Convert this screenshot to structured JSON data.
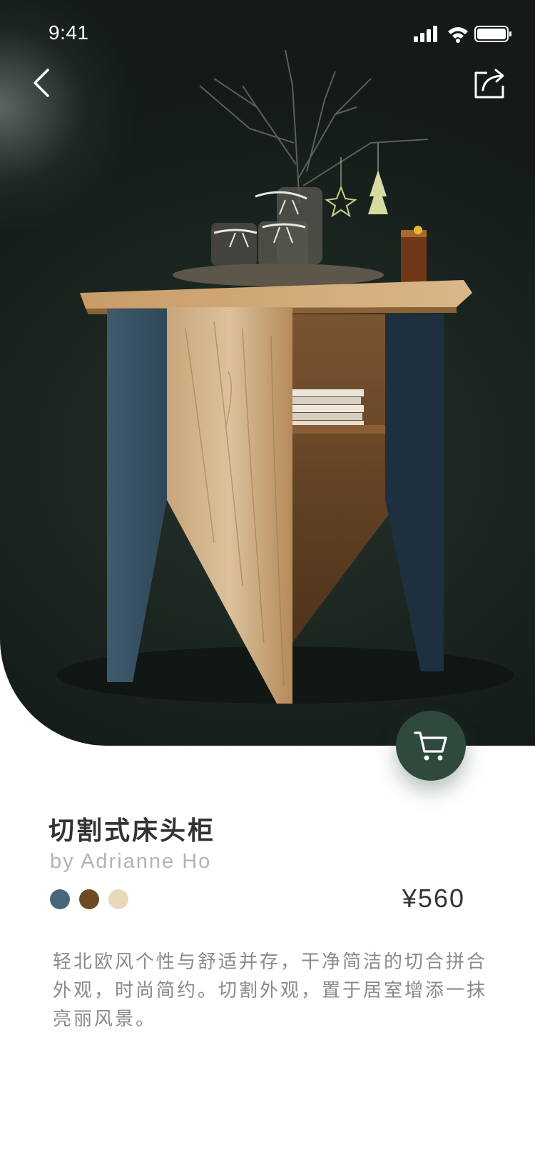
{
  "status_bar": {
    "time": "9:41",
    "icons": [
      "signal-icon",
      "wifi-icon",
      "battery-icon"
    ]
  },
  "nav": {
    "back_icon": "chevron-left-icon",
    "share_icon": "share-icon"
  },
  "hero_image": {
    "subject": "cut-style wooden bedside table with blue legs, jars and branches on top",
    "cart_button_icon": "cart-icon"
  },
  "product": {
    "title": "切割式床头柜",
    "designer": "by Adrianne Ho",
    "price": "¥560",
    "colors": [
      "#48667a",
      "#6e4a24",
      "#e8d9b9"
    ],
    "description": "轻北欧风个性与舒适并存，干净简洁的切合拼合外观，时尚简约。切割外观，置于居室增添一抹亮丽风景。"
  },
  "theme": {
    "accent": "#2f4a3d",
    "hero_background": "#1b2520",
    "title_color": "#333333",
    "muted_text": "#8a8a8a"
  }
}
